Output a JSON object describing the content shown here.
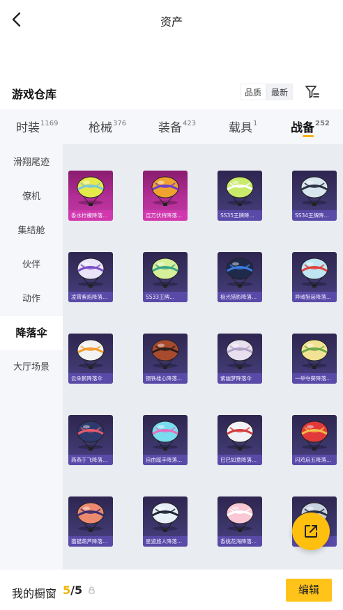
{
  "topbar": {
    "title": "资产"
  },
  "warehouse": {
    "title": "游戏仓库",
    "sort_options": [
      "品质",
      "最新"
    ]
  },
  "tabs": [
    {
      "label": "时装",
      "count": "1169"
    },
    {
      "label": "枪械",
      "count": "376"
    },
    {
      "label": "装备",
      "count": "423"
    },
    {
      "label": "载具",
      "count": "1"
    },
    {
      "label": "战备",
      "count": "252"
    }
  ],
  "sidebar": {
    "items": [
      "滑翔尾迹",
      "僚机",
      "集结舱",
      "伙伴",
      "动作",
      "降落伞",
      "大厅场景"
    ],
    "selected": "降落伞"
  },
  "items": [
    {
      "name": "香水柠檬降落...",
      "rarity": "pink",
      "colors": [
        "#e6e94a",
        "#7cc7d8"
      ]
    },
    {
      "name": "百万伏特降落...",
      "rarity": "pink",
      "colors": [
        "#f0a230",
        "#6b3fd0"
      ]
    },
    {
      "name": "SS35王牌降...",
      "rarity": "purple",
      "colors": [
        "#c9ea6a",
        "#ffffff"
      ]
    },
    {
      "name": "SS34王牌降...",
      "rarity": "purple",
      "colors": [
        "#d8e6ee",
        "#2a2f44"
      ]
    },
    {
      "name": "凌霄紫焰降落...",
      "rarity": "purple",
      "colors": [
        "#e9e4f7",
        "#7b4fc9"
      ]
    },
    {
      "name": "SS33王牌...",
      "rarity": "purple",
      "colors": [
        "#d6ef9a",
        "#3aa68a"
      ]
    },
    {
      "name": "极光猎影降落...",
      "rarity": "purple",
      "colors": [
        "#1f2a4a",
        "#3b7de0"
      ]
    },
    {
      "name": "异域狙装降落...",
      "rarity": "purple",
      "colors": [
        "#bfe6f2",
        "#e0413c"
      ]
    },
    {
      "name": "云朵鹅降落伞",
      "rarity": "purple",
      "colors": [
        "#f2f2f2",
        "#f39a2a"
      ]
    },
    {
      "name": "钢铁雄心降落...",
      "rarity": "purple",
      "colors": [
        "#a84a2e",
        "#2a1e1e"
      ]
    },
    {
      "name": "紫幽梦降落伞",
      "rarity": "purple",
      "colors": [
        "#e8e0ef",
        "#b0a2c8"
      ]
    },
    {
      "name": "一举夺葵降落...",
      "rarity": "purple",
      "colors": [
        "#f2e394",
        "#6ea84a"
      ]
    },
    {
      "name": "燕燕于飞降落...",
      "rarity": "purple",
      "colors": [
        "#2e3a6e",
        "#e85a6a"
      ]
    },
    {
      "name": "自由蹊手降落...",
      "rarity": "purple",
      "colors": [
        "#7adcef",
        "#e76cbd"
      ]
    },
    {
      "name": "巳巳如意降落...",
      "rarity": "purple",
      "colors": [
        "#f2f2f6",
        "#d43a3a"
      ]
    },
    {
      "name": "闪鸡启五降落...",
      "rarity": "purple",
      "colors": [
        "#e23a3a",
        "#f0c04a"
      ]
    },
    {
      "name": "猫猫葫芦降落...",
      "rarity": "purple",
      "colors": [
        "#ec8a70",
        "#3b2e6e"
      ]
    },
    {
      "name": "星迹旅人降落...",
      "rarity": "purple",
      "colors": [
        "#e6f0f6",
        "#1e2433"
      ]
    },
    {
      "name": "香桃花海降落...",
      "rarity": "purple",
      "colors": [
        "#f9c8d4",
        "#ffffff"
      ]
    },
    {
      "name": "",
      "rarity": "purple",
      "colors": [
        "#c8d2e0",
        "#2a2f44"
      ]
    }
  ],
  "bottom": {
    "showcase_label": "我的橱窗",
    "used": "5",
    "separator": "/",
    "total": "5",
    "edit_label": "编辑"
  },
  "icons": {
    "back": "back-arrow-icon",
    "filter": "filter-icon",
    "lock": "lock-icon",
    "share": "external-link-icon"
  }
}
